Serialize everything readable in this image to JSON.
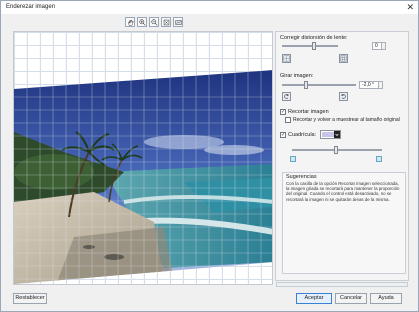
{
  "window": {
    "title": "Enderezar imagen"
  },
  "toolbar": {
    "icons": [
      "hand-icon",
      "zoom-in-icon",
      "zoom-out-icon",
      "fit-icon",
      "actual-size-icon"
    ]
  },
  "panel": {
    "lens_label": "Corregir distorsión de lente:",
    "lens_value": "0",
    "rotate_label": "Girar imagen:",
    "rotate_value": "-2,0 °",
    "crop_label": "Recortar imagen",
    "crop_checked": "✓",
    "crop_resample_label": "Recortar y volver a muestrear al tamaño original",
    "grid_label": "Cuadrícula:",
    "grid_checked": "✓",
    "grid_color": "#c9c4ea"
  },
  "tips": {
    "title": "Sugerencias",
    "text": "Con la casilla de la opción Recortar imagen seleccionada, la imagen girada se recortará para mantener la proporción del original.  Cuando el control está desactivado, no se recortará la imagen ni se quitarán áreas de la misma."
  },
  "buttons": {
    "reset": "Restablecer",
    "ok": "Aceptar",
    "cancel": "Cancelar",
    "help": "Ayuda"
  },
  "colors": {
    "accent": "#3b7fd6",
    "grid": "#d4dde8"
  }
}
